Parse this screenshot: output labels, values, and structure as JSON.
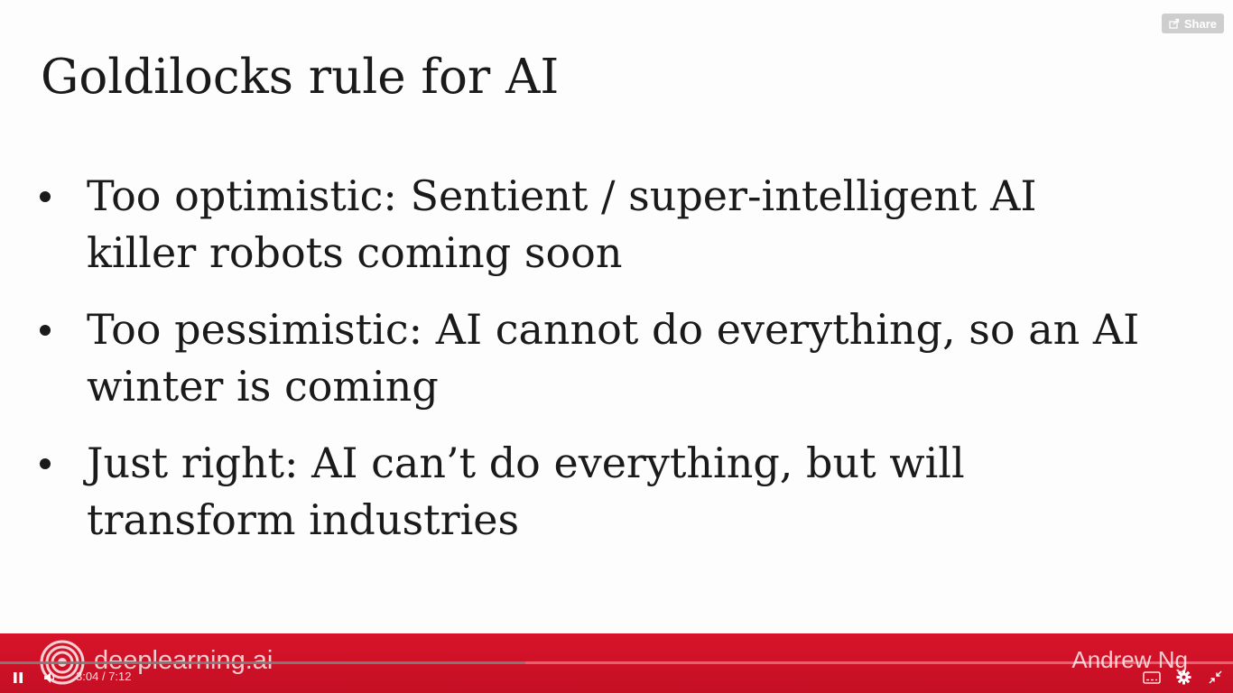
{
  "slide": {
    "title": "Goldilocks rule for AI",
    "bullets": [
      {
        "text": "Too optimistic: Sentient / super-intelligent AI killer robots coming soon"
      },
      {
        "text": "Too pessimistic: AI cannot do everything, so an AI winter is coming"
      },
      {
        "text": "Just right: AI can’t do everything, but will transform industries"
      }
    ]
  },
  "share": {
    "label": "Share",
    "icon": "share-icon"
  },
  "branding": {
    "logo_icon": "deeplearning-ai-logo",
    "name": "deeplearning.ai",
    "author": "Andrew Ng",
    "band_color": "#d7142a"
  },
  "player": {
    "current_time": "3:04",
    "duration": "7:12",
    "time_separator": "/",
    "progress": 0.426,
    "icons": {
      "play_pause": "pause-icon",
      "volume": "volume-icon",
      "captions": "captions-icon",
      "settings": "gear-icon",
      "fullscreen": "exit-fullscreen-icon"
    }
  }
}
